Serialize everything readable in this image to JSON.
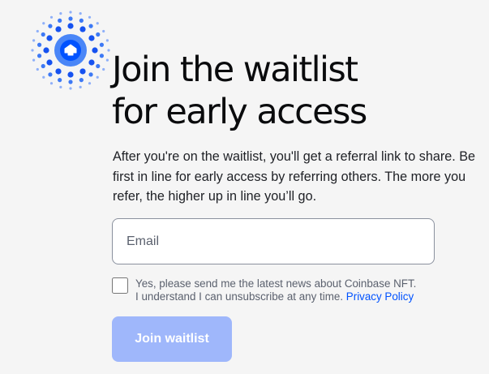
{
  "logo": {
    "icon": "coinbase-nft-burst-logo",
    "colors": {
      "dots_dark": "#1652f0",
      "dots_mid": "#3d79f5",
      "dots_light": "#8fb0f9",
      "core_outer": "#4a86f7",
      "core_inner": "#0052ff"
    }
  },
  "headline": {
    "line1": "Join the waitlist",
    "line2": "for early access"
  },
  "description": "After you're on the waitlist, you'll get a referral link to share. Be first in line for early access by referring others. The more you refer, the higher up in line you’ll go.",
  "form": {
    "email_placeholder": "Email",
    "email_value": "",
    "newsletter_checked": false,
    "consent_line1": "Yes, please send me the latest news about Coinbase NFT.",
    "consent_line2": "I understand I can unsubscribe at any time.",
    "privacy_link": "Privacy Policy",
    "submit_label": "Join waitlist",
    "submit_disabled": true
  },
  "colors": {
    "background": "#f5f5f5",
    "text": "#0a0b0d",
    "muted_text": "#5b616e",
    "link": "#0052ff",
    "button_disabled_bg": "#9fb7fb",
    "button_text": "#ffffff",
    "input_border": "#8a919e"
  }
}
